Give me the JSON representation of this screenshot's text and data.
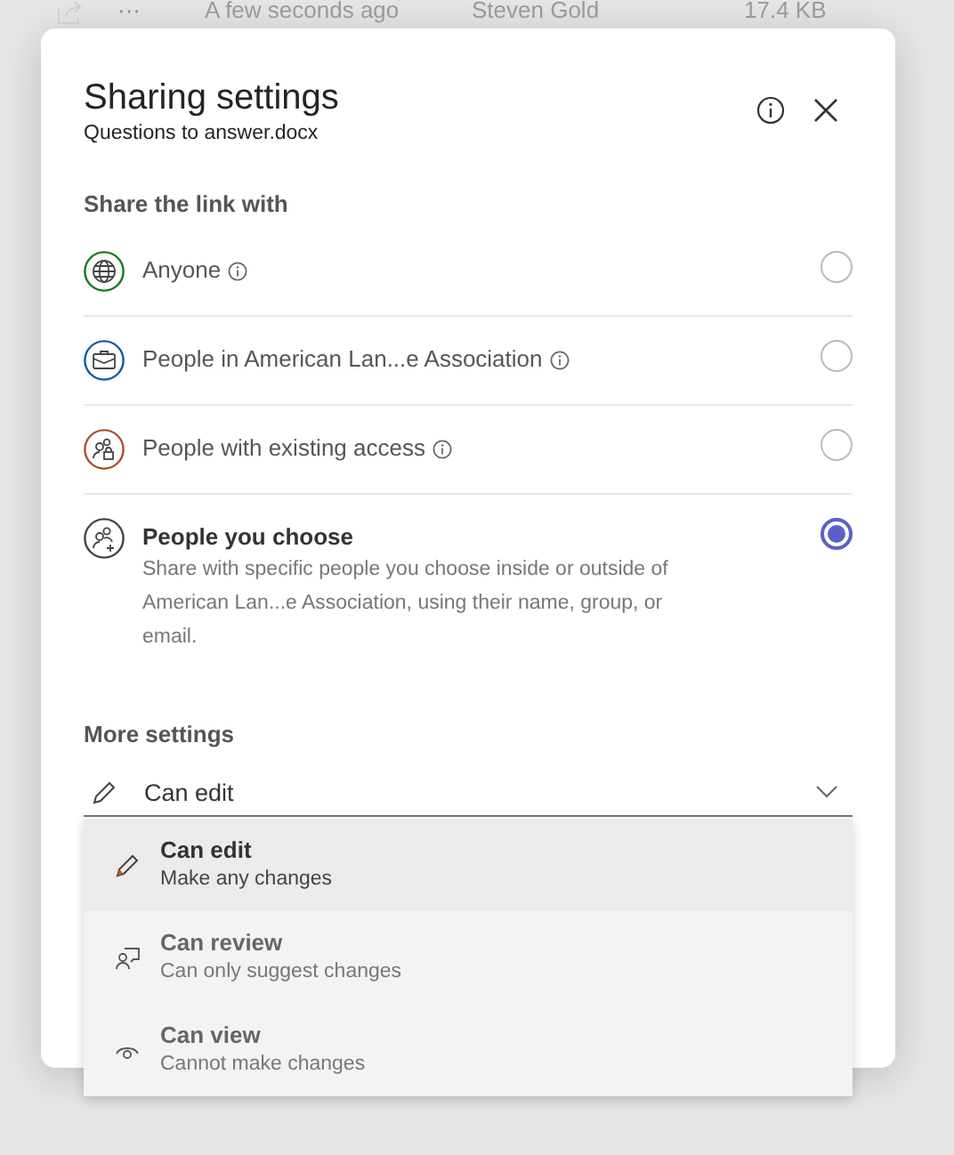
{
  "background_row": {
    "time": "A few seconds ago",
    "owner": "Steven Gold",
    "size": "17.4 KB",
    "more": "···"
  },
  "dialog": {
    "title": "Sharing settings",
    "subtitle": "Questions to answer.docx"
  },
  "share_heading": "Share the link with",
  "options": [
    {
      "label": "Anyone",
      "info": true,
      "color": "#107c10",
      "selected": false
    },
    {
      "label": "People in American Lan...e Association",
      "info": true,
      "color": "#0f5ba7",
      "selected": false
    },
    {
      "label": "People with existing access",
      "info": true,
      "color": "#a4542a",
      "selected": false
    },
    {
      "label": "People you choose",
      "info": false,
      "color": "#444444",
      "selected": true,
      "description": "Share with specific people you choose inside or outside of American Lan...e Association, using their name, group, or email."
    }
  ],
  "more_heading": "More settings",
  "permission": {
    "value": "Can edit",
    "expanded": true
  },
  "menu": [
    {
      "title": "Can edit",
      "subtitle": "Make any changes",
      "selected": true
    },
    {
      "title": "Can review",
      "subtitle": "Can only suggest changes",
      "selected": false
    },
    {
      "title": "Can view",
      "subtitle": "Cannot make changes",
      "selected": false
    }
  ]
}
